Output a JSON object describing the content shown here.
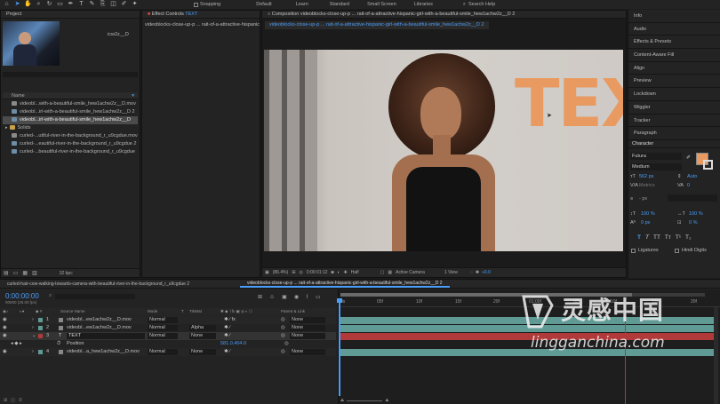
{
  "workspaces": [
    "Default",
    "Learn",
    "Standard",
    "Small Screen",
    "Libraries"
  ],
  "topbar": {
    "snapping": "Snapping",
    "search_help": "Search Help"
  },
  "project": {
    "tab": "Project",
    "thumb_label": "icw2z__D",
    "column_name": "Name",
    "files": [
      "videobl...with-a-beautiful-smile_hew1achw2z__D.mov",
      "videobl...irl-with-a-beautiful-smile_hew1achw2z__D 2",
      "videobl...irl-with-a-beautiful-smile_hew1achw2z__D",
      "Solids",
      "curled-...utiful-river-in-the-background_r_u9cgdue.mov",
      "curled-...eautiful-river-in-the-background_r_u9cgdue 2",
      "curled-...beautiful-river-in-the-background_r_u9cgdue"
    ],
    "bpc": "32 bpc"
  },
  "effect_controls": {
    "tab_prefix": "Effect Controls",
    "tab_layer": "TEXT",
    "path": "videoblocks-close-up-p ... rait-of-a-attractive-hispanic"
  },
  "composition": {
    "tab": "Composition videoblocks-close-up-p ... rait-of-a-attractive-hispanic-girl-with-a-beautiful-smile_hew1achw2z__D 2",
    "subtab": "videoblocks-close-up-p ... rait-of-a-attractive-hispanic-girl-with-a-beautiful-smile_hew1achw2z__D 2",
    "overlay_text": "TEX",
    "footer": {
      "zoom": "(86.4%)",
      "timecode": "0:00:01:12",
      "resolution": "Half",
      "camera": "Active Camera",
      "view": "1 View",
      "exposure": "+0.0"
    }
  },
  "right_panels": [
    "Info",
    "Audio",
    "Effects & Presets",
    "Content-Aware Fill",
    "Align",
    "Preview",
    "Lockdown",
    "Wiggler",
    "Tracker",
    "Paragraph"
  ],
  "character": {
    "title": "Character",
    "font": "Futura",
    "style": "Medium",
    "size": "562 px",
    "leading": "Auto",
    "kerning": "Metrics",
    "tracking": "0",
    "stroke": "- px",
    "vscale": "100 %",
    "hscale": "100 %",
    "baseline": "0 px",
    "tsume": "0 %",
    "ligatures": "Ligatures",
    "hindi_digits": "Hindi Digits",
    "fill_color": "#e89a61"
  },
  "timeline": {
    "tabs": [
      "curled-hair-cow-walking-towards-camera-with-beautiful-river-in-the-background_r_u9cgdue 2",
      "videoblocks-close-up-p ... rait-of-a-attractive-hispanic-girl-with-a-beautiful-smile_hew1achw2z__D 2"
    ],
    "timecode": "0:00:00:00",
    "timecode_sub": "00000 (25.00 fps)",
    "columns": {
      "source_name": "Source Name",
      "mode": "Mode",
      "t": "T",
      "trkmat": "TrkMat",
      "parent": "Parent & Link"
    },
    "layers": [
      {
        "num": "1",
        "name": "videobl...ew1achw2z__D.mov",
        "mode": "Normal",
        "trkmat": "",
        "parent": "None"
      },
      {
        "num": "2",
        "name": "videobl...ew1achw2z__D.mov",
        "mode": "Normal",
        "trkmat": "Alpha",
        "parent": "None"
      },
      {
        "num": "3",
        "name": "TEXT",
        "mode": "Normal",
        "trkmat": "None",
        "parent": "None"
      },
      {
        "num": "4",
        "name": "videobl...a_hew1achw2z__D.mov",
        "mode": "Normal",
        "trkmat": "None",
        "parent": "None"
      }
    ],
    "position_label": "Position",
    "position_value": "581.0,404.0",
    "ruler": [
      "0s",
      "05f",
      "10f",
      "15f",
      "20f",
      "01:00f",
      "05f",
      "10f",
      "15f",
      "20f"
    ],
    "playhead_fraction": 0.0,
    "work_marker_fraction": 0.8
  },
  "watermark": {
    "cn": "灵感中国",
    "url": "lingganchina.com"
  },
  "colors": {
    "accent": "#4a9df8",
    "layer_teal": "#5f9a94",
    "layer_red": "#b03a3a",
    "text_orange": "#e89a61"
  }
}
